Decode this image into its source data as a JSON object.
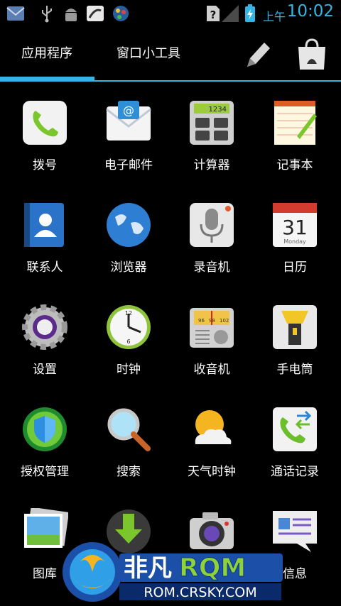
{
  "status_bar": {
    "ampm": "上午",
    "time": "10:02",
    "icons": [
      "email-icon",
      "usb-icon",
      "android-debug-icon",
      "download-icon",
      "palette-icon",
      "no-sim-icon",
      "signal-icon",
      "battery-charging-icon"
    ]
  },
  "tabs": [
    {
      "label": "应用程序",
      "selected": true
    },
    {
      "label": "窗口小工具",
      "selected": false
    }
  ],
  "accent_color": "#33b5e5",
  "apps": [
    {
      "label": "拨号",
      "icon": "phone-icon"
    },
    {
      "label": "电子邮件",
      "icon": "email-app-icon"
    },
    {
      "label": "计算器",
      "icon": "calculator-icon",
      "display": "1234"
    },
    {
      "label": "记事本",
      "icon": "notepad-icon"
    },
    {
      "label": "联系人",
      "icon": "contacts-icon"
    },
    {
      "label": "浏览器",
      "icon": "browser-globe-icon"
    },
    {
      "label": "录音机",
      "icon": "microphone-icon"
    },
    {
      "label": "日历",
      "icon": "calendar-icon",
      "day": "31",
      "weekday": "Monday"
    },
    {
      "label": "设置",
      "icon": "settings-gear-icon"
    },
    {
      "label": "时钟",
      "icon": "clock-icon"
    },
    {
      "label": "收音机",
      "icon": "radio-icon",
      "dial": [
        "96",
        "98",
        "102"
      ]
    },
    {
      "label": "手电筒",
      "icon": "flashlight-icon"
    },
    {
      "label": "授权管理",
      "icon": "shield-icon"
    },
    {
      "label": "搜索",
      "icon": "search-magnifier-icon"
    },
    {
      "label": "天气时钟",
      "icon": "weather-icon"
    },
    {
      "label": "通话记录",
      "icon": "call-log-icon"
    },
    {
      "label": "图库",
      "icon": "gallery-icon"
    },
    {
      "label": "",
      "icon": "downloads-icon"
    },
    {
      "label": "",
      "icon": "camera-icon"
    },
    {
      "label": "信息",
      "icon": "messaging-icon"
    }
  ],
  "watermark": {
    "title_cn": "非凡",
    "title_en": "RQM",
    "url": "ROM.CRSKY.COM"
  }
}
